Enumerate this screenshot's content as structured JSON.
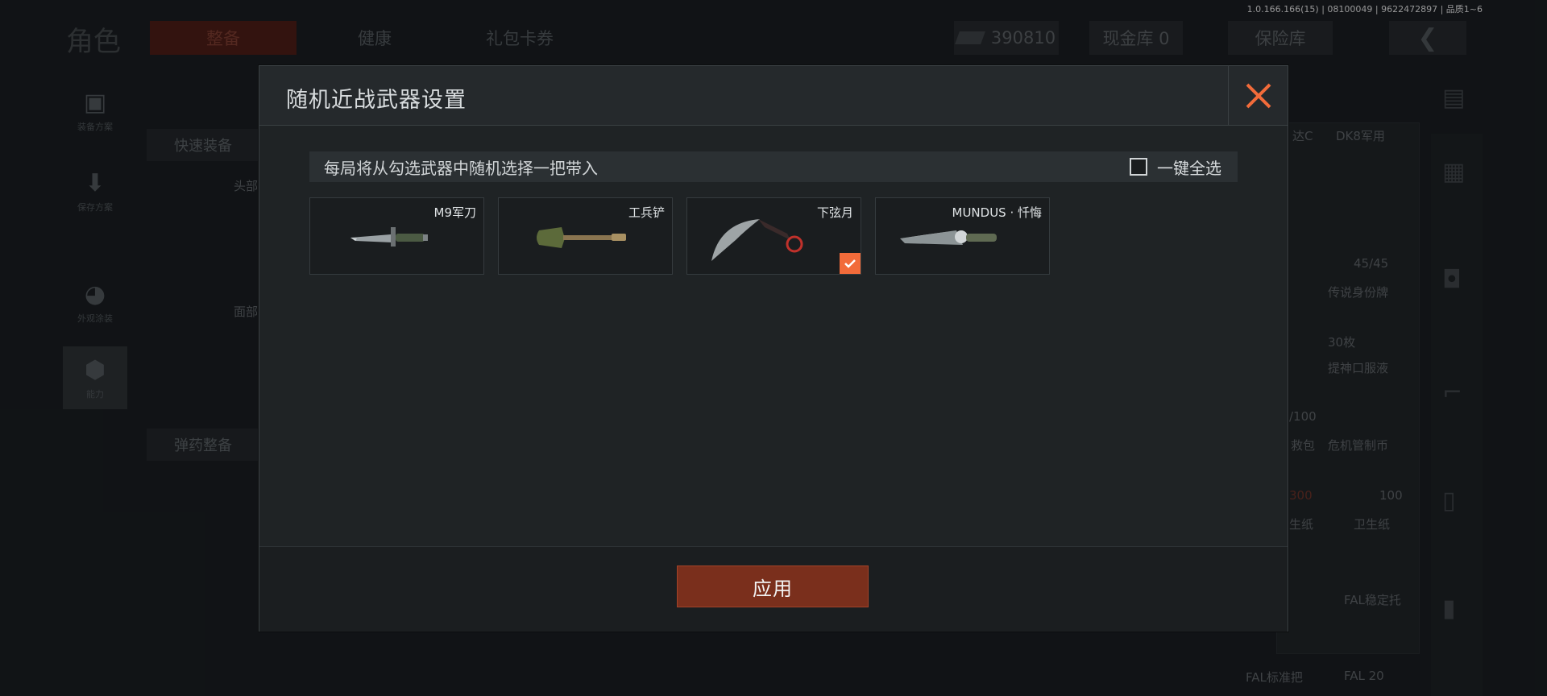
{
  "version_info": "1.0.166.166(15) | 08100049 | 9622472897 | 品质1~6",
  "background": {
    "title": "角色",
    "tabs": [
      "整备",
      "健康",
      "礼包卡券"
    ],
    "currency_value": "390810",
    "cash_vault": "现金库 0",
    "insurance": "保险库",
    "side_items": [
      "装备方案",
      "保存方案",
      "外观涂装",
      "能力"
    ],
    "quick_equip": "快速装备",
    "ammo_equip": "弹药整备",
    "head_label": "头部",
    "face_label": "面部",
    "right_labels": [
      "达C",
      "DK8军用",
      "45/45",
      "传说身份牌",
      "30枚",
      "提神口服液",
      "/100",
      "危机管制币",
      "救包",
      "100",
      "300",
      "生纸",
      "卫生纸",
      "FAL稳定托",
      "FAL标准把",
      "FAL 20"
    ]
  },
  "modal": {
    "title": "随机近战武器设置",
    "info_text": "每局将从勾选武器中随机选择一把带入",
    "select_all_label": "一键全选",
    "select_all_checked": false,
    "weapons": [
      {
        "name": "M9军刀",
        "selected": false
      },
      {
        "name": "工兵铲",
        "selected": false
      },
      {
        "name": "下弦月",
        "selected": true
      },
      {
        "name": "MUNDUS · 忏悔",
        "selected": false
      }
    ],
    "apply_label": "应用",
    "accent_color": "#f26b3a",
    "apply_color": "#7a2f1c"
  }
}
